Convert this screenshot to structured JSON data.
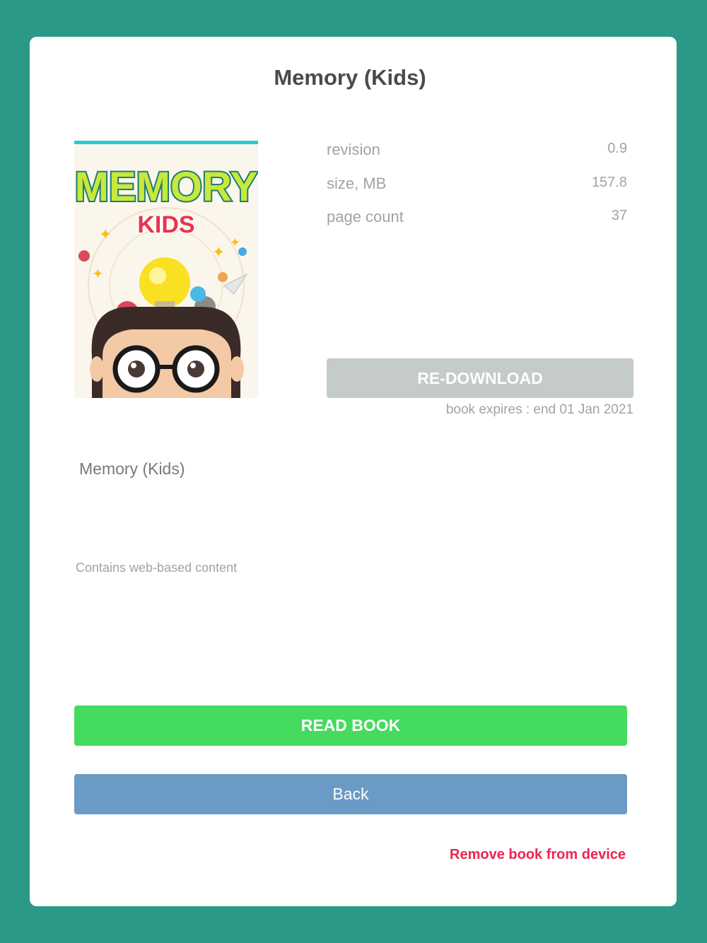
{
  "header": {
    "title": "Memory (Kids)"
  },
  "cover": {
    "title_line1": "MEMORY",
    "title_line2": "KIDS",
    "accent_color": "#2ec9d3"
  },
  "meta": [
    {
      "label": "revision",
      "value": "0.9"
    },
    {
      "label": "size, MB",
      "value": "157.8"
    },
    {
      "label": "page count",
      "value": "37"
    }
  ],
  "actions": {
    "redownload_label": "RE-DOWNLOAD",
    "expires_text": "book expires : end 01 Jan 2021",
    "read_label": "READ BOOK",
    "back_label": "Back",
    "remove_label": "Remove book from device"
  },
  "book": {
    "name": "Memory (Kids)",
    "web_note": "Contains web-based content"
  },
  "colors": {
    "background": "#2a9a86",
    "redownload_button": "#c5cbc7",
    "read_button": "#45db5e",
    "back_button": "#6b9ac4",
    "remove_link": "#ef2350"
  }
}
